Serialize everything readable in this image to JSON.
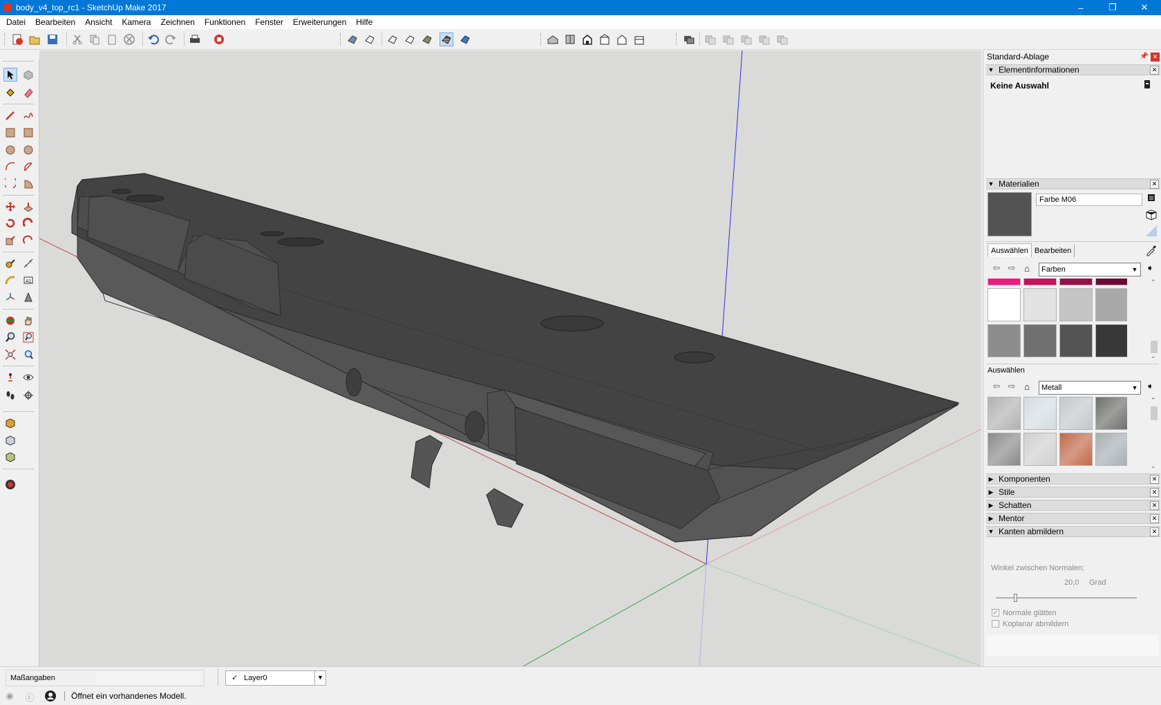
{
  "window": {
    "title": "body_v4_top_rc1 - SketchUp Make 2017",
    "minimize": "–",
    "restore": "❐",
    "close": "✕"
  },
  "menu": [
    "Datei",
    "Bearbeiten",
    "Ansicht",
    "Kamera",
    "Zeichnen",
    "Funktionen",
    "Fenster",
    "Erweiterungen",
    "Hilfe"
  ],
  "tray": {
    "title": "Standard-Ablage",
    "entity_info": {
      "header": "Elementinformationen",
      "selection": "Keine Auswahl"
    },
    "materials": {
      "header": "Materialien",
      "current_name": "Farbe M06",
      "current_color": "#535353",
      "tabs": [
        "Auswählen",
        "Bearbeiten"
      ],
      "library1": "Farben",
      "colors": [
        "#ea1b7e",
        "#c5125f",
        "#95114a",
        "#6a0b35",
        "#ffffff",
        "#e2e2e2",
        "#c5c5c5",
        "#a9a9a9",
        "#8d8d8d",
        "#707070",
        "#545454",
        "#383838",
        "#1c1c1c",
        "#000000"
      ],
      "section2_label": "Auswählen",
      "library2": "Metall",
      "metal_swatches": [
        "#b2b2b2",
        "#d4dce2",
        "#c2c8cc",
        "#6d6f6c",
        "#8a8a8a",
        "#cfcfcf",
        "#c0694a",
        "#a7aeb3"
      ]
    },
    "collapsed": [
      "Komponenten",
      "Stile",
      "Schatten",
      "Mentor"
    ],
    "soften": {
      "header": "Kanten abmildern",
      "label": "Winkel zwischen Normalen:",
      "value": "20,0",
      "unit": "Grad",
      "slider_fraction": 0.13,
      "smooth": "Normale glätten",
      "coplanar": "Koplanar abmildern"
    }
  },
  "status": {
    "measurements_label": "Maßangaben",
    "layer": "Layer0",
    "message": "Öffnet ein vorhandenes Modell."
  },
  "colors": {
    "titlebar": "#0078d7",
    "model_top": "#434343",
    "model_side": "#5a5a5a",
    "viewport_bg": "#dadad9"
  }
}
